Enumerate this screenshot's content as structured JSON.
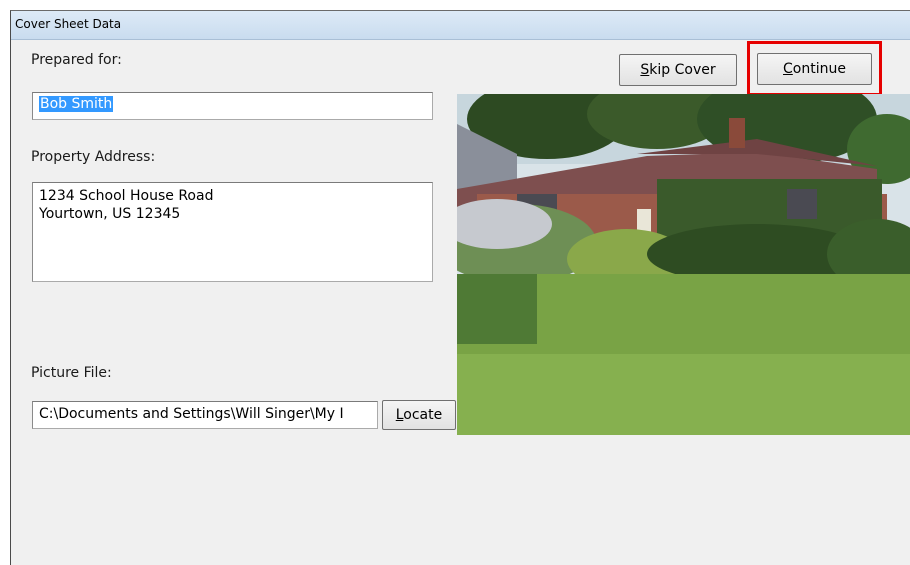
{
  "window": {
    "title": "Cover Sheet Data"
  },
  "prepared_for": {
    "label": "Prepared for:",
    "value": "Bob Smith"
  },
  "property_address": {
    "label": "Property Address:",
    "line1": "1234 School House Road",
    "line2": "Yourtown, US 12345"
  },
  "picture_file": {
    "label": "Picture File:",
    "value": "C:\\Documents and Settings\\Will Singer\\My I",
    "locate_label": "Locate"
  },
  "buttons": {
    "skip_cover": "Skip Cover",
    "continue": "Continue"
  },
  "preview": {
    "subject": "house-photo"
  },
  "colors": {
    "highlight": "#e60000",
    "selection": "#3399ff"
  }
}
